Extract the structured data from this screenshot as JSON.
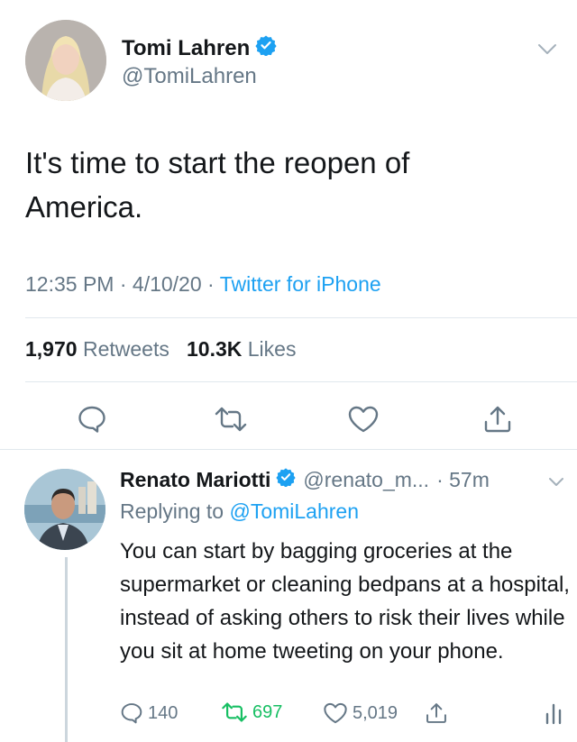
{
  "tweet": {
    "display_name": "Tomi Lahren",
    "handle": "@TomiLahren",
    "text": "It's time to start the reopen of America.",
    "time": "12:35 PM",
    "date": "4/10/20",
    "source": "Twitter for iPhone",
    "retweets_count": "1,970",
    "retweets_label": "Retweets",
    "likes_count": "10.3K",
    "likes_label": "Likes"
  },
  "reply": {
    "display_name": "Renato Mariotti",
    "handle": "@renato_m...",
    "time": "57m",
    "replying_prefix": "Replying to",
    "replying_to": "@TomiLahren",
    "text": "You can start by bagging groceries at the supermarket or cleaning bedpans at a hospital, instead of asking others to risk their lives while you sit at home tweeting on your phone.",
    "reply_count": "140",
    "retweet_count": "697",
    "like_count": "5,019"
  },
  "colors": {
    "accent": "#1da1f2",
    "retweet_green": "#17bf63",
    "secondary_text": "#657786"
  },
  "icons": {
    "verified": "verified-badge-icon",
    "chevron": "chevron-down-icon",
    "reply": "reply-bubble-icon",
    "retweet": "retweet-icon",
    "like": "heart-icon",
    "share": "share-icon",
    "analytics": "analytics-icon"
  }
}
